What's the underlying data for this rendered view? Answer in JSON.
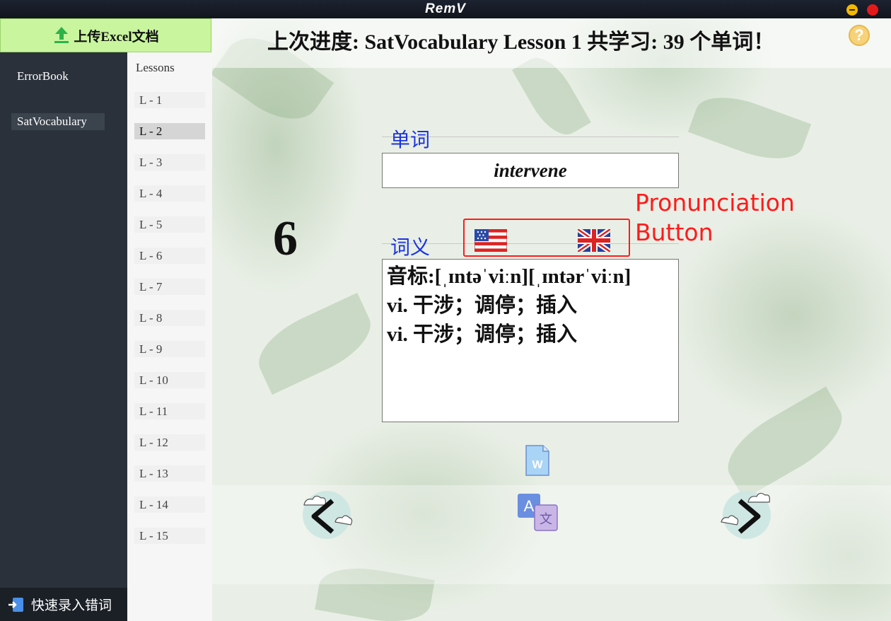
{
  "window": {
    "title": "RemV",
    "controls": [
      "minimize-button",
      "close-button"
    ]
  },
  "sidebar": {
    "upload_label": "上传Excel文档",
    "books": [
      {
        "label": "ErrorBook"
      },
      {
        "label": "SatVocabulary",
        "selected": true
      }
    ],
    "quick_entry_label": "快速录入错词"
  },
  "lessons": {
    "title": "Lessons",
    "items": [
      {
        "label": "L - 1"
      },
      {
        "label": "L - 2",
        "selected": true
      },
      {
        "label": "L - 3"
      },
      {
        "label": "L - 4"
      },
      {
        "label": "L - 5"
      },
      {
        "label": "L - 6"
      },
      {
        "label": "L - 7"
      },
      {
        "label": "L - 8"
      },
      {
        "label": "L - 9"
      },
      {
        "label": "L - 10"
      },
      {
        "label": "L - 11"
      },
      {
        "label": "L - 12"
      },
      {
        "label": "L - 13"
      },
      {
        "label": "L - 14"
      },
      {
        "label": "L - 15"
      }
    ]
  },
  "main": {
    "progress_text": "上次进度: SatVocabulary Lesson 1  共学习: 39 个单词！",
    "help_icon": "?",
    "word_label": "单词",
    "word": "intervene",
    "word_index": "6",
    "meaning_label": "词义",
    "definition_lines": [
      "音标:[ˌɪntəˈviːn][ˌɪntərˈviːn]",
      "vi. 干涉；调停；插入",
      "vi. 干涉；调停；插入"
    ],
    "pronunciation": {
      "us_icon": "us-flag-icon",
      "uk_icon": "uk-flag-icon"
    },
    "annotation_lines": [
      "Pronunciation",
      "Button"
    ],
    "nav": {
      "prev_icon": "cloud-prev-icon",
      "next_icon": "cloud-next-icon"
    },
    "tools": {
      "word_doc_icon": "word-document-icon",
      "translate_icon": "translate-icon"
    }
  },
  "colors": {
    "sidebar_bg": "#2a313a",
    "upload_bg": "#c9f59e",
    "label_blue": "#1a33e0",
    "annotation_red": "#ff1b1b",
    "help_yellow": "#f6d27a"
  }
}
